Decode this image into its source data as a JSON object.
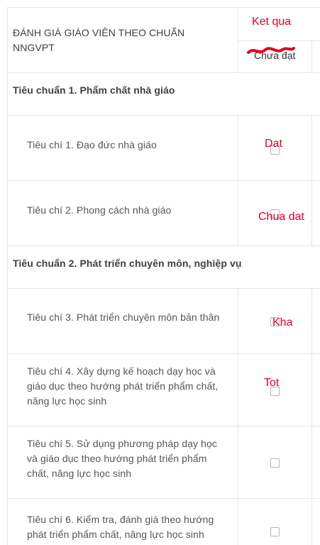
{
  "header": {
    "title": "ĐÁNH GIÁ GIÁO VIÊN THEO CHUẨN NNGVPT",
    "result_label": "Ket qua",
    "column_label": "Chưa đạt"
  },
  "standards": [
    {
      "title": "Tiêu chuẩn 1. Phẩm chất nhà giáo",
      "criteria": [
        {
          "label": "Tiêu chí 1. Đạo đức nhà giáo",
          "result": "Dat",
          "checked": false
        },
        {
          "label": "Tiêu chí 2. Phong cách nhà giáo",
          "result": "Chua dat",
          "checked": false
        }
      ]
    },
    {
      "title": "Tiêu chuẩn 2. Phát triển chuyên môn, nghiệp vụ",
      "criteria": [
        {
          "label": "Tiêu chí 3. Phát triển chuyên môn bản thân",
          "result": "Kha",
          "checked": false
        },
        {
          "label": "Tiêu chí 4. Xây dựng kế hoạch dạy học và giáo dục theo hướng phát triển phẩm chất, năng lực học sinh",
          "result": "Tot",
          "checked": false
        },
        {
          "label": "Tiêu chí 5. Sử dụng phương pháp dạy học và giáo dục theo hướng phát triển phẩm chất, năng lực học sinh",
          "result": "",
          "checked": false
        },
        {
          "label": "Tiêu chí 6. Kiểm tra, đánh giá theo hướng phát triển phẩm chất, năng lực học sinh",
          "result": "",
          "checked": false
        }
      ]
    }
  ],
  "colors": {
    "annotation": "#e5001f",
    "border": "#e6e6e6",
    "text": "#555555"
  }
}
